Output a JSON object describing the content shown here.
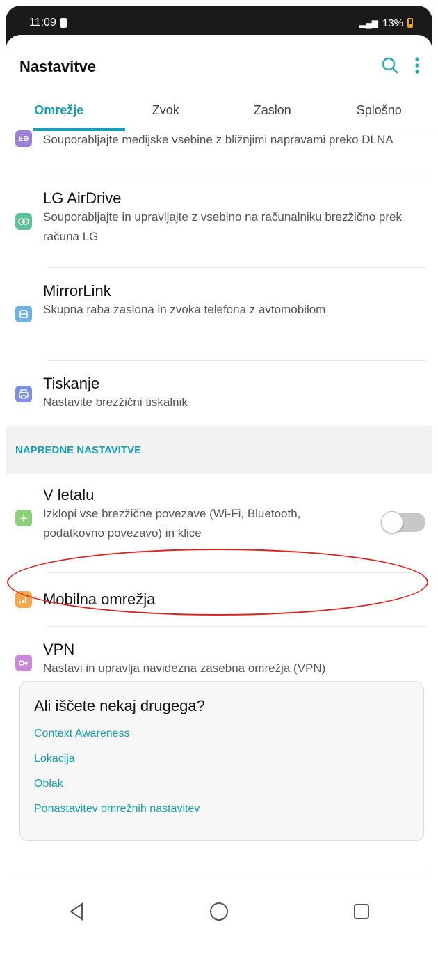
{
  "status": {
    "time": "11:09",
    "battery": "13%"
  },
  "header": {
    "title": "Nastavitve"
  },
  "tabs": [
    {
      "label": "Omrežje"
    },
    {
      "label": "Zvok"
    },
    {
      "label": "Zaslon"
    },
    {
      "label": "Splošno"
    }
  ],
  "items": {
    "dlna": {
      "icon_text": "E⊕",
      "subtitle": "Souporabljajte medijske vsebine z bližnjimi napravami preko DLNA"
    },
    "airdrive": {
      "title": "LG AirDrive",
      "subtitle": "Souporabljajte in upravljajte z vsebino na računalniku brezžično prek računa LG"
    },
    "mirrorlink": {
      "title": "MirrorLink",
      "subtitle": "Skupna raba zaslona in zvoka telefona z avtomobilom"
    },
    "print": {
      "title": "Tiskanje",
      "subtitle": "Nastavite brezžični tiskalnik"
    }
  },
  "section": {
    "label": "NAPREDNE NASTAVITVE"
  },
  "advanced": {
    "airplane": {
      "title": "V letalu",
      "subtitle": "Izklopi vse brezžične povezave (Wi-Fi, Bluetooth, podatkovno povezavo) in klice",
      "enabled": false
    },
    "mobile": {
      "title": "Mobilna omrežja"
    },
    "vpn": {
      "title": "VPN",
      "subtitle": "Nastavi in upravlja navidezna zasebna omrežja (VPN)"
    }
  },
  "suggestions": {
    "title": "Ali iščete nekaj drugega?",
    "links": [
      "Context Awareness",
      "Lokacija",
      "Oblak",
      "Ponastavitev omrežnih nastavitev"
    ]
  },
  "colors": {
    "accent": "#14a0b5",
    "highlight": "#dd2222"
  },
  "icons": {
    "search": "search-icon",
    "more": "more-vert-icon",
    "back": "nav-back-icon",
    "home": "nav-home-icon",
    "recents": "nav-recents-icon"
  }
}
